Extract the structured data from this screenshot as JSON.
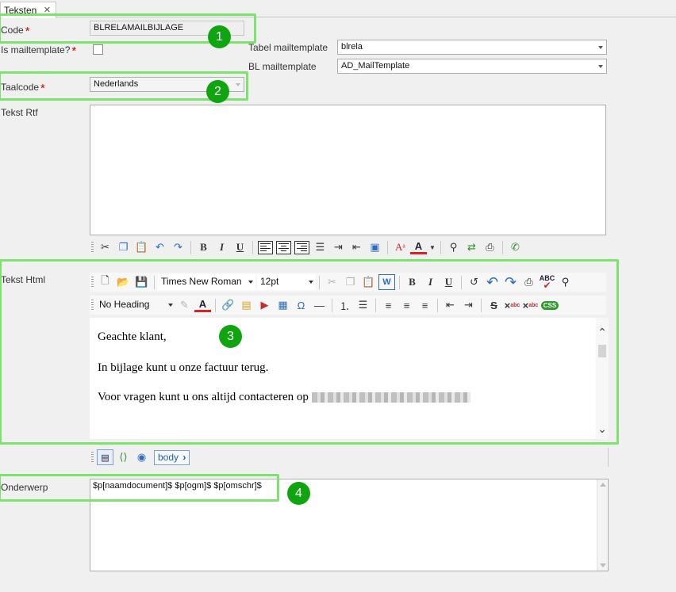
{
  "tab": {
    "label": "Teksten",
    "close": "✕"
  },
  "form": {
    "code": {
      "label": "Code",
      "required_mark": "*",
      "value": "BLRELAMAILBIJLAGE"
    },
    "is_mailtemplate": {
      "label": "Is mailtemplate?",
      "required_mark": "*"
    },
    "tabel_mailtemplate": {
      "label": "Tabel mailtemplate",
      "value": "blrela"
    },
    "bl_mailtemplate": {
      "label": "BL mailtemplate",
      "value": "AD_MailTemplate"
    },
    "taalcode": {
      "label": "Taalcode",
      "required_mark": "*",
      "value": "Nederlands"
    },
    "tekst_rtf": {
      "label": "Tekst Rtf"
    },
    "tekst_html": {
      "label": "Tekst Html"
    },
    "onderwerp": {
      "label": "Onderwerp",
      "value": "$p[naamdocument]$ $p[ogm]$ $p[omschr]$"
    }
  },
  "badges": [
    "1",
    "2",
    "3",
    "4"
  ],
  "html_toolbar": {
    "font": "Times New Roman",
    "size": "12pt",
    "heading": "No Heading",
    "css_label": "CSS",
    "abc_label": "ABC"
  },
  "editor": {
    "line1": "Geachte klant,",
    "line2": "In bijlage kunt u onze factuur terug.",
    "line3": "Voor vragen kunt u ons altijd contacteren op"
  },
  "bottom_toolbar": {
    "tag": "body"
  },
  "colors": {
    "highlight": "#7de36e",
    "badge": "#10a510",
    "required": "#d00000"
  },
  "icons": {
    "rtf_toolbar": [
      "cut-icon",
      "copy-icon",
      "paste-icon",
      "undo-icon",
      "redo-icon",
      "bold-icon",
      "italic-icon",
      "underline-icon",
      "align-left-icon",
      "align-center-icon",
      "align-right-icon",
      "bullet-list-icon",
      "indent-icon",
      "outdent-icon",
      "image-icon",
      "font-size-icon",
      "font-color-icon",
      "find-icon",
      "replace-icon",
      "print-icon",
      "phone-icon"
    ],
    "html_toolbar1": [
      "new-document-icon",
      "open-folder-icon",
      "save-icon",
      "cut-icon",
      "copy-icon",
      "paste-icon",
      "paste-word-icon",
      "bold-icon",
      "italic-icon",
      "underline-icon",
      "refresh-icon",
      "undo-icon",
      "redo-icon",
      "print-icon",
      "spellcheck-icon",
      "find-icon"
    ],
    "html_toolbar2": [
      "highlight-icon",
      "font-color-icon",
      "hyperlink-icon",
      "image-icon",
      "media-icon",
      "table-icon",
      "omega-icon",
      "horizontal-rule-icon",
      "numbered-list-icon",
      "bullet-list-icon",
      "align-left-icon",
      "align-center-icon",
      "align-right-icon",
      "outdent-icon",
      "indent-icon",
      "strikethrough-icon",
      "superscript-icon",
      "subscript-icon",
      "css-icon"
    ]
  }
}
